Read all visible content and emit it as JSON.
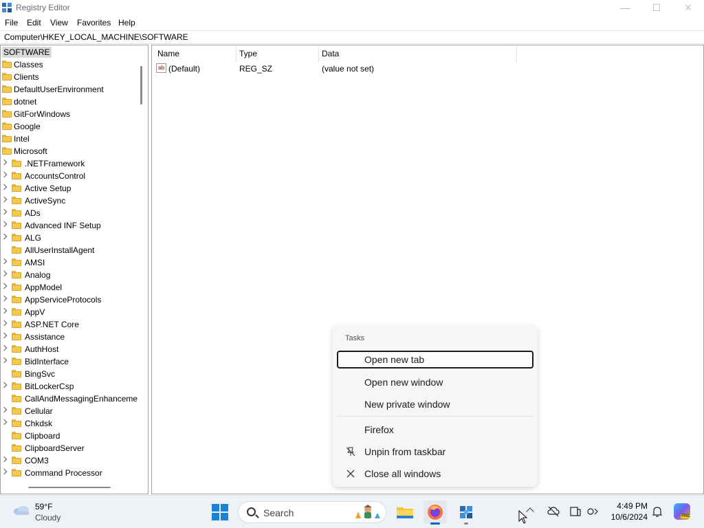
{
  "window": {
    "title": "Registry Editor",
    "controls": {
      "minimize": "—",
      "maximize": "☐",
      "close": "✕"
    }
  },
  "menu": {
    "file": "File",
    "edit": "Edit",
    "view": "View",
    "favorites": "Favorites",
    "help": "Help"
  },
  "address": "Computer\\HKEY_LOCAL_MACHINE\\SOFTWARE",
  "tree": {
    "root": "SOFTWARE",
    "top_items": [
      "Classes",
      "Clients",
      "DefaultUserEnvironment",
      "dotnet",
      "GitForWindows",
      "Google",
      "Intel",
      "Microsoft"
    ],
    "microsoft_children": [
      {
        "label": ".NETFramework",
        "expandable": true
      },
      {
        "label": "AccountsControl",
        "expandable": true
      },
      {
        "label": "Active Setup",
        "expandable": true
      },
      {
        "label": "ActiveSync",
        "expandable": true
      },
      {
        "label": "ADs",
        "expandable": true
      },
      {
        "label": "Advanced INF Setup",
        "expandable": true
      },
      {
        "label": "ALG",
        "expandable": true
      },
      {
        "label": "AllUserInstallAgent",
        "expandable": false
      },
      {
        "label": "AMSI",
        "expandable": true
      },
      {
        "label": "Analog",
        "expandable": true
      },
      {
        "label": "AppModel",
        "expandable": true
      },
      {
        "label": "AppServiceProtocols",
        "expandable": true
      },
      {
        "label": "AppV",
        "expandable": true
      },
      {
        "label": "ASP.NET Core",
        "expandable": true
      },
      {
        "label": "Assistance",
        "expandable": true
      },
      {
        "label": "AuthHost",
        "expandable": true
      },
      {
        "label": "BidInterface",
        "expandable": true
      },
      {
        "label": "BingSvc",
        "expandable": false
      },
      {
        "label": "BitLockerCsp",
        "expandable": true
      },
      {
        "label": "CallAndMessagingEnhanceme",
        "expandable": false
      },
      {
        "label": "Cellular",
        "expandable": true
      },
      {
        "label": "Chkdsk",
        "expandable": true
      },
      {
        "label": "Clipboard",
        "expandable": false
      },
      {
        "label": "ClipboardServer",
        "expandable": false
      },
      {
        "label": "COM3",
        "expandable": true
      },
      {
        "label": "Command Processor",
        "expandable": true
      }
    ]
  },
  "values": {
    "columns": {
      "name": "Name",
      "type": "Type",
      "data": "Data"
    },
    "rows": [
      {
        "name": "(Default)",
        "type": "REG_SZ",
        "data": "(value not set)",
        "icon": "ab"
      }
    ]
  },
  "jumplist": {
    "header": "Tasks",
    "items": [
      {
        "label": "Open new tab",
        "icon": ""
      },
      {
        "label": "Open new window",
        "icon": ""
      },
      {
        "label": "New private window",
        "icon": ""
      },
      {
        "label": "Firefox",
        "icon": ""
      },
      {
        "label": "Unpin from taskbar",
        "icon": "unpin-icon"
      },
      {
        "label": "Close all windows",
        "icon": "close-icon"
      }
    ]
  },
  "taskbar": {
    "weather_temp": "59°F",
    "weather_desc": "Cloudy",
    "search_label": "Search",
    "clock_time": "4:49 PM",
    "clock_date": "10/6/2024",
    "copilot_badge": "PRE"
  },
  "colors": {
    "folder": "#f4c94c",
    "accent": "#0067c0",
    "start": "#1883d7",
    "taskbar": "#eef1f6"
  }
}
